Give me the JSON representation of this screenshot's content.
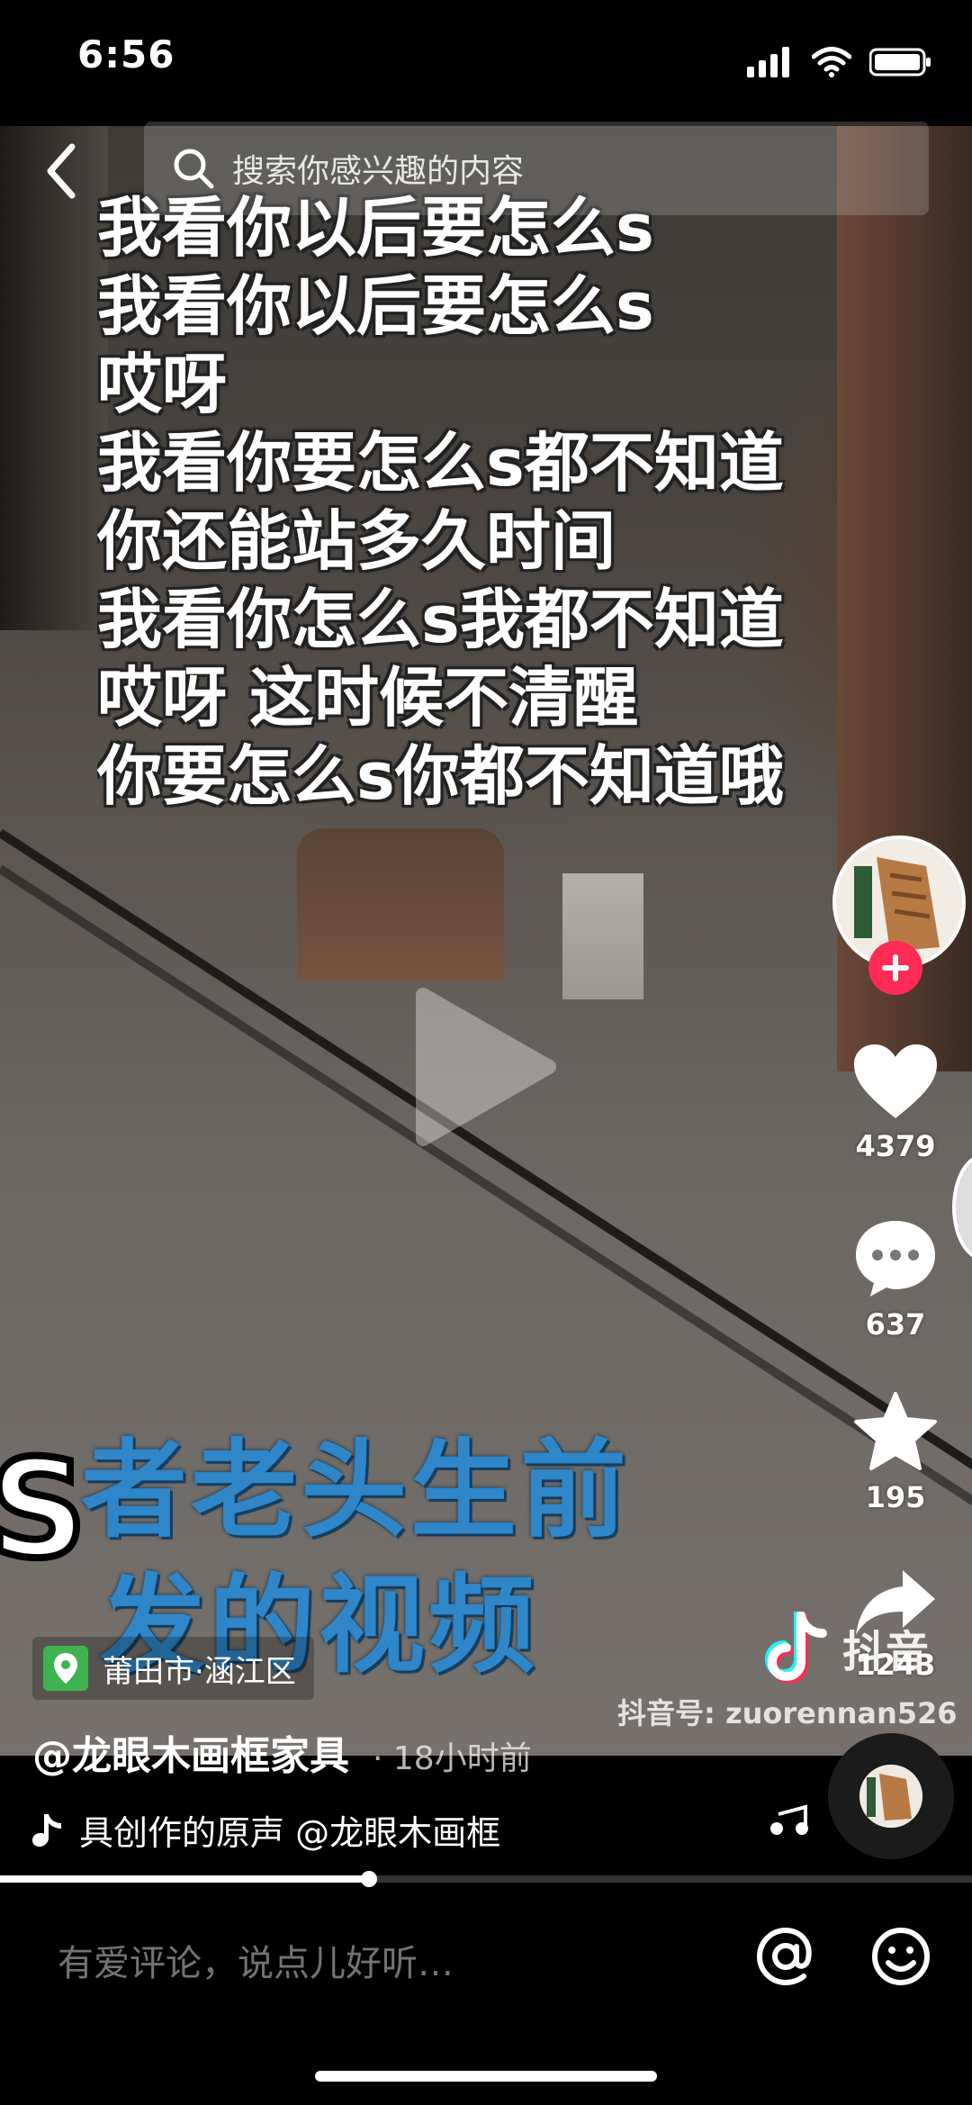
{
  "status_bar": {
    "time": "6:56"
  },
  "search": {
    "placeholder": "搜索你感兴趣的内容"
  },
  "lyrics": [
    "我看你以后要怎么s",
    "我看你以后要怎么s",
    "哎呀",
    "我看你要怎么s都不知道",
    "你还能站多久时间",
    "我看你怎么s我都不知道",
    "哎呀 这时候不清醒",
    "你要怎么s你都不知道哦"
  ],
  "video_overlay": {
    "s_mark": "S",
    "caption_line1": "者老头生前",
    "caption_line2": "发的视频"
  },
  "actions": {
    "likes": "4379",
    "comments": "637",
    "favorites": "195",
    "shares": "1243"
  },
  "brand": {
    "name": "抖音",
    "douyin_id": "抖音号: zuorennan526"
  },
  "location": {
    "text": "莆田市·涵江区"
  },
  "post": {
    "author": "@龙眼木画框家具",
    "time": "· 18小时前"
  },
  "music": {
    "text": "具创作的原声    @龙眼木画框"
  },
  "progress": {
    "fraction": 0.38
  },
  "comment": {
    "placeholder": "有爱评论，说点儿好听…"
  },
  "colors": {
    "accent": "#fe2c55",
    "location_green": "#3fb352"
  }
}
